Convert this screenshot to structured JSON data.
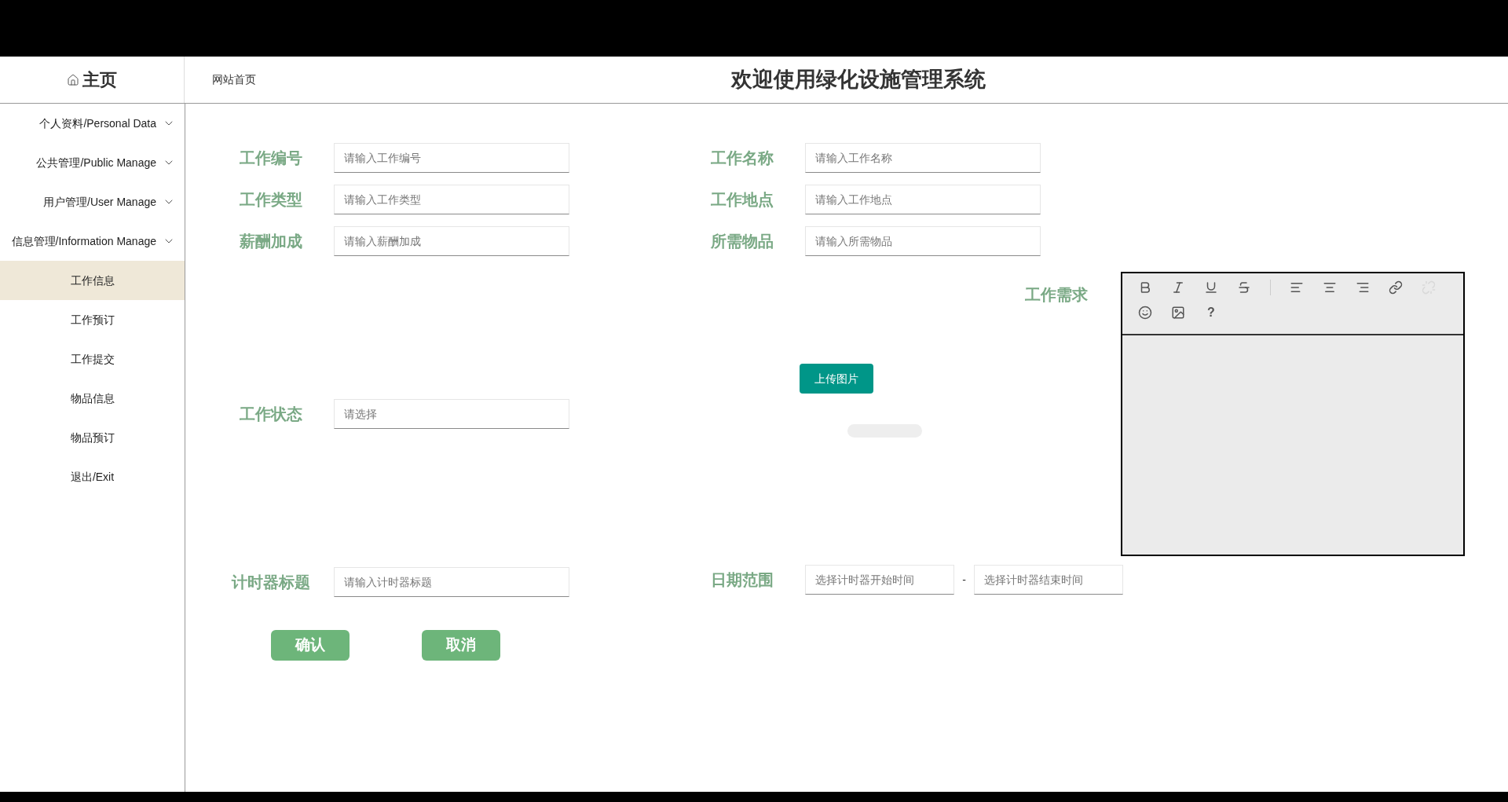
{
  "header": {
    "home_title": "主页",
    "breadcrumb": "网站首页",
    "title": "欢迎使用绿化设施管理系统"
  },
  "sidebar": {
    "items": [
      {
        "kind": "group",
        "label": "个人资料/Personal Data",
        "selected": false
      },
      {
        "kind": "group",
        "label": "公共管理/Public Manage",
        "selected": false
      },
      {
        "kind": "group",
        "label": "用户管理/User Manage",
        "selected": false
      },
      {
        "kind": "group",
        "label": "信息管理/Information Manage",
        "selected": false,
        "children": [
          {
            "label": "工作信息",
            "selected": true
          },
          {
            "label": "工作预订",
            "selected": false
          },
          {
            "label": "工作提交",
            "selected": false
          },
          {
            "label": "物品信息",
            "selected": false
          },
          {
            "label": "物品预订",
            "selected": false
          }
        ]
      },
      {
        "kind": "link",
        "label": "退出/Exit",
        "selected": false
      }
    ]
  },
  "form": {
    "rows": [
      [
        {
          "label": "工作编号",
          "placeholder": "请输入工作编号"
        },
        {
          "label": "工作名称",
          "placeholder": "请输入工作名称"
        }
      ],
      [
        {
          "label": "工作类型",
          "placeholder": "请输入工作类型"
        },
        {
          "label": "工作地点",
          "placeholder": "请输入工作地点"
        }
      ],
      [
        {
          "label": "薪酬加成",
          "placeholder": "请输入薪酬加成"
        },
        {
          "label": "所需物品",
          "placeholder": "请输入所需物品"
        }
      ]
    ],
    "status": {
      "label": "工作状态",
      "placeholder": "请选择"
    },
    "upload_button": "上传图片",
    "upload_progress": {
      "level": 0
    },
    "editor": {
      "label": "工作需求",
      "toolbar": [
        {
          "kind": "bold",
          "disabled": false
        },
        {
          "kind": "italic",
          "disabled": false
        },
        {
          "kind": "underline",
          "disabled": false
        },
        {
          "kind": "strike",
          "disabled": false
        },
        {
          "kind": "separator"
        },
        {
          "kind": "align-left",
          "disabled": false
        },
        {
          "kind": "align-center",
          "disabled": false
        },
        {
          "kind": "align-right",
          "disabled": false
        },
        {
          "kind": "link",
          "disabled": false
        },
        {
          "kind": "unlink",
          "disabled": true
        },
        {
          "kind": "emoji",
          "disabled": false
        },
        {
          "kind": "image",
          "disabled": false
        },
        {
          "kind": "help",
          "text": "?",
          "disabled": false
        }
      ]
    },
    "timer_title": {
      "label": "计时器标题",
      "placeholder": "请输入计时器标题"
    },
    "date_range": {
      "label": "日期范围",
      "start_placeholder": "选择计时器开始时间",
      "separator": "-",
      "end_placeholder": "选择计时器结束时间"
    },
    "buttons": [
      "确认",
      "取消"
    ]
  }
}
